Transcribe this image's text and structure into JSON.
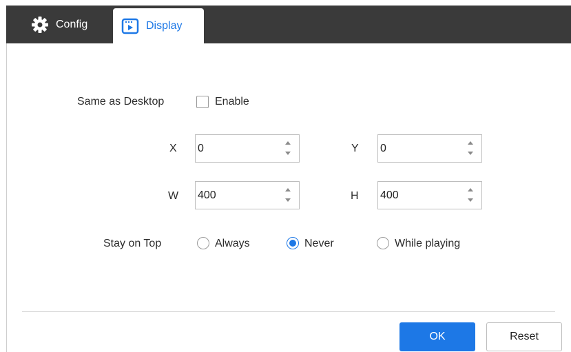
{
  "tabs": {
    "config": {
      "label": "Config",
      "icon": "gear-icon"
    },
    "display": {
      "label": "Display",
      "icon": "play-screen-icon",
      "active": true
    }
  },
  "form": {
    "same_as_desktop": {
      "label": "Same as Desktop",
      "checkbox_label": "Enable",
      "checked": false
    },
    "x": {
      "label": "X",
      "value": "0"
    },
    "y": {
      "label": "Y",
      "value": "0"
    },
    "w": {
      "label": "W",
      "value": "400"
    },
    "h": {
      "label": "H",
      "value": "400"
    },
    "stay_on_top": {
      "label": "Stay on Top",
      "options": [
        "Always",
        "Never",
        "While playing"
      ],
      "selected": "Never"
    }
  },
  "buttons": {
    "ok": "OK",
    "reset": "Reset"
  },
  "colors": {
    "accent": "#1d78e6",
    "tabbar": "#3a3a3a"
  }
}
